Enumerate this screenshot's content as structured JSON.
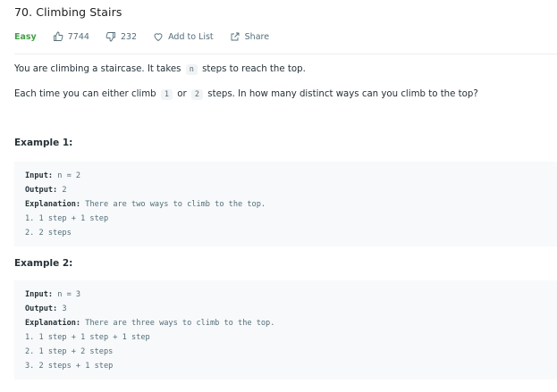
{
  "problem": {
    "title": "70. Climbing Stairs",
    "difficulty": "Easy",
    "likes": "7744",
    "dislikes": "232",
    "add_to_list": "Add to List",
    "share": "Share",
    "difficulty_color": "#43a047"
  },
  "description": {
    "p1_before": "You are climbing a staircase. It takes",
    "p1_code": "n",
    "p1_after": "steps to reach the top.",
    "p2_before": "Each time you can either climb",
    "p2_code1": "1",
    "p2_mid": "or",
    "p2_code2": "2",
    "p2_after": "steps. In how many distinct ways can you climb to the top?"
  },
  "examples": [
    {
      "title": "Example 1:",
      "input_label": "Input:",
      "input_value": "n = 2",
      "output_label": "Output:",
      "output_value": "2",
      "explanation_label": "Explanation:",
      "explanation_value": "There are two ways to climb to the top.",
      "steps": [
        "1. 1 step + 1 step",
        "2. 2 steps"
      ]
    },
    {
      "title": "Example 2:",
      "input_label": "Input:",
      "input_value": "n = 3",
      "output_label": "Output:",
      "output_value": "3",
      "explanation_label": "Explanation:",
      "explanation_value": "There are three ways to climb to the top.",
      "steps": [
        "1. 1 step + 1 step + 1 step",
        "2. 1 step + 2 steps",
        "3. 2 steps + 1 step"
      ]
    }
  ],
  "icons": {
    "like": "thumbs-up-icon",
    "dislike": "thumbs-down-icon",
    "add_to_list": "heart-icon",
    "share": "share-icon"
  }
}
